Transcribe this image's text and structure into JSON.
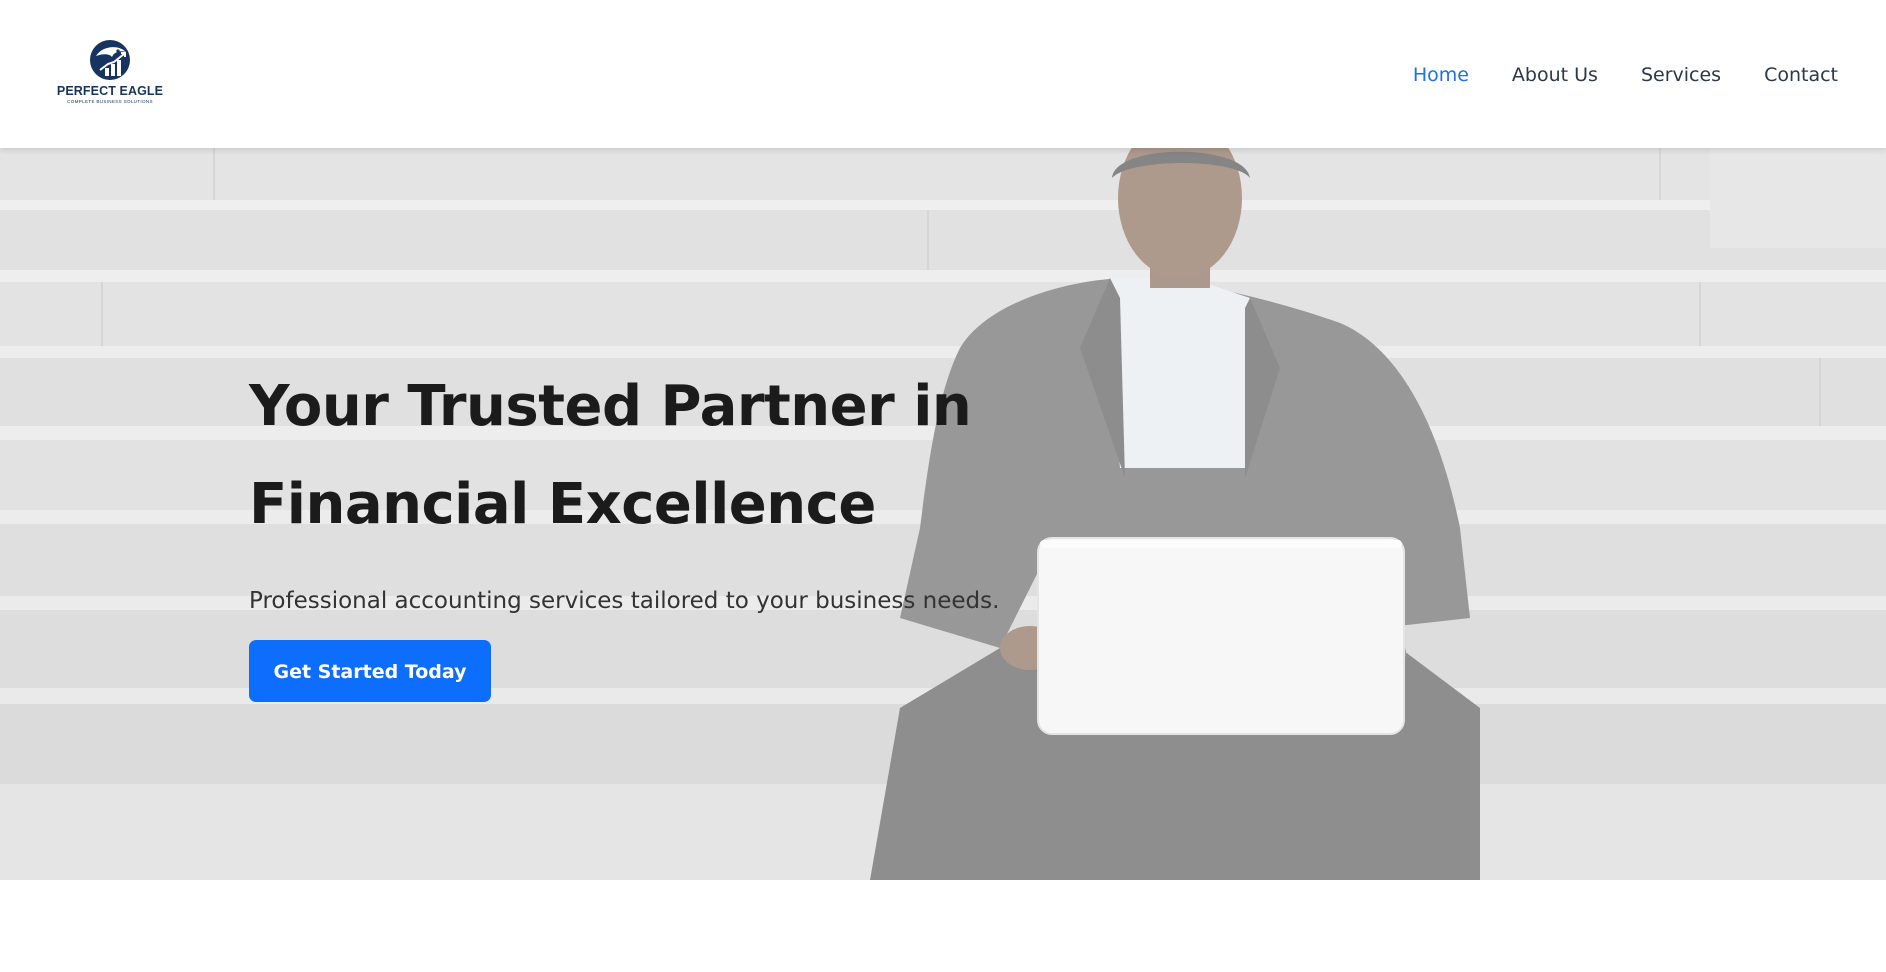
{
  "brand": {
    "name": "PERFECT EAGLE",
    "tagline": "COMPLETE BUSINESS SOLUTIONS",
    "logo_icon": "eagle-growth-chart-icon",
    "color": "#16345f"
  },
  "nav": {
    "items": [
      {
        "label": "Home",
        "active": true
      },
      {
        "label": "About Us",
        "active": false
      },
      {
        "label": "Services",
        "active": false
      },
      {
        "label": "Contact",
        "active": false
      }
    ],
    "active_color": "#1f6fe5",
    "text_color": "#2d3748"
  },
  "hero": {
    "title_line1": "Your Trusted Partner in",
    "title_line2": "Financial Excellence",
    "subtitle": "Professional accounting services tailored to your business needs.",
    "cta_label": "Get Started Today",
    "cta_color": "#0d6efd",
    "background": "man-with-laptop-on-stone-steps-photo"
  }
}
